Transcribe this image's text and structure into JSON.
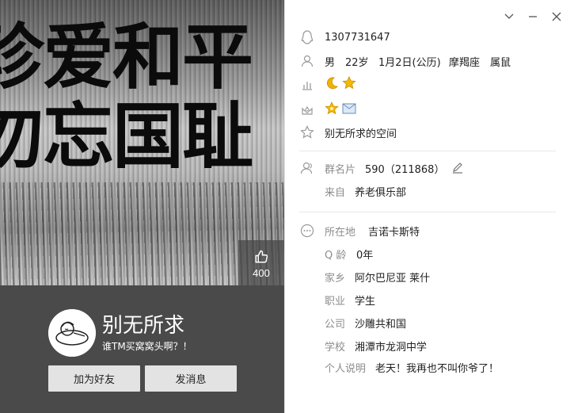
{
  "cover": {
    "line1": "珍爱和平",
    "line2": "勿忘国耻",
    "likes": "400"
  },
  "profile": {
    "nickname": "别无所求",
    "signature": "谁TM买窝窝头啊？！",
    "add_friend": "加为好友",
    "send_message": "发消息"
  },
  "info": {
    "qq_number": "1307731647",
    "gender": "男",
    "age": "22岁",
    "birthday": "1月2日(公历)",
    "zodiac": "摩羯座",
    "chinese_zodiac": "属鼠",
    "level_icons": [
      "moon-icon",
      "star-icon"
    ],
    "vip_icons": [
      "star-icon",
      "mail-icon"
    ],
    "space": "别无所求的空间"
  },
  "group": {
    "card_label": "群名片",
    "card_value": "590（211868）",
    "from_label": "来自",
    "from_value": "养老俱乐部"
  },
  "details": [
    {
      "label": "所在地",
      "value": "吉诺卡斯特"
    },
    {
      "label": "Q 龄",
      "value": "0年"
    },
    {
      "label": "家乡",
      "value": "阿尔巴尼亚 莱什"
    },
    {
      "label": "职业",
      "value": "学生"
    },
    {
      "label": "公司",
      "value": "沙雕共和国"
    },
    {
      "label": "学校",
      "value": "湘潭市龙洞中学"
    },
    {
      "label": "个人说明",
      "value": "老天！我再也不叫你爷了！"
    }
  ],
  "colors": {
    "left_bg": "#4a4a4a",
    "button_bg": "#e3e3e3",
    "icon_gray": "#9a9a9a",
    "star": "#f5b800",
    "moon": "#f2b200"
  }
}
